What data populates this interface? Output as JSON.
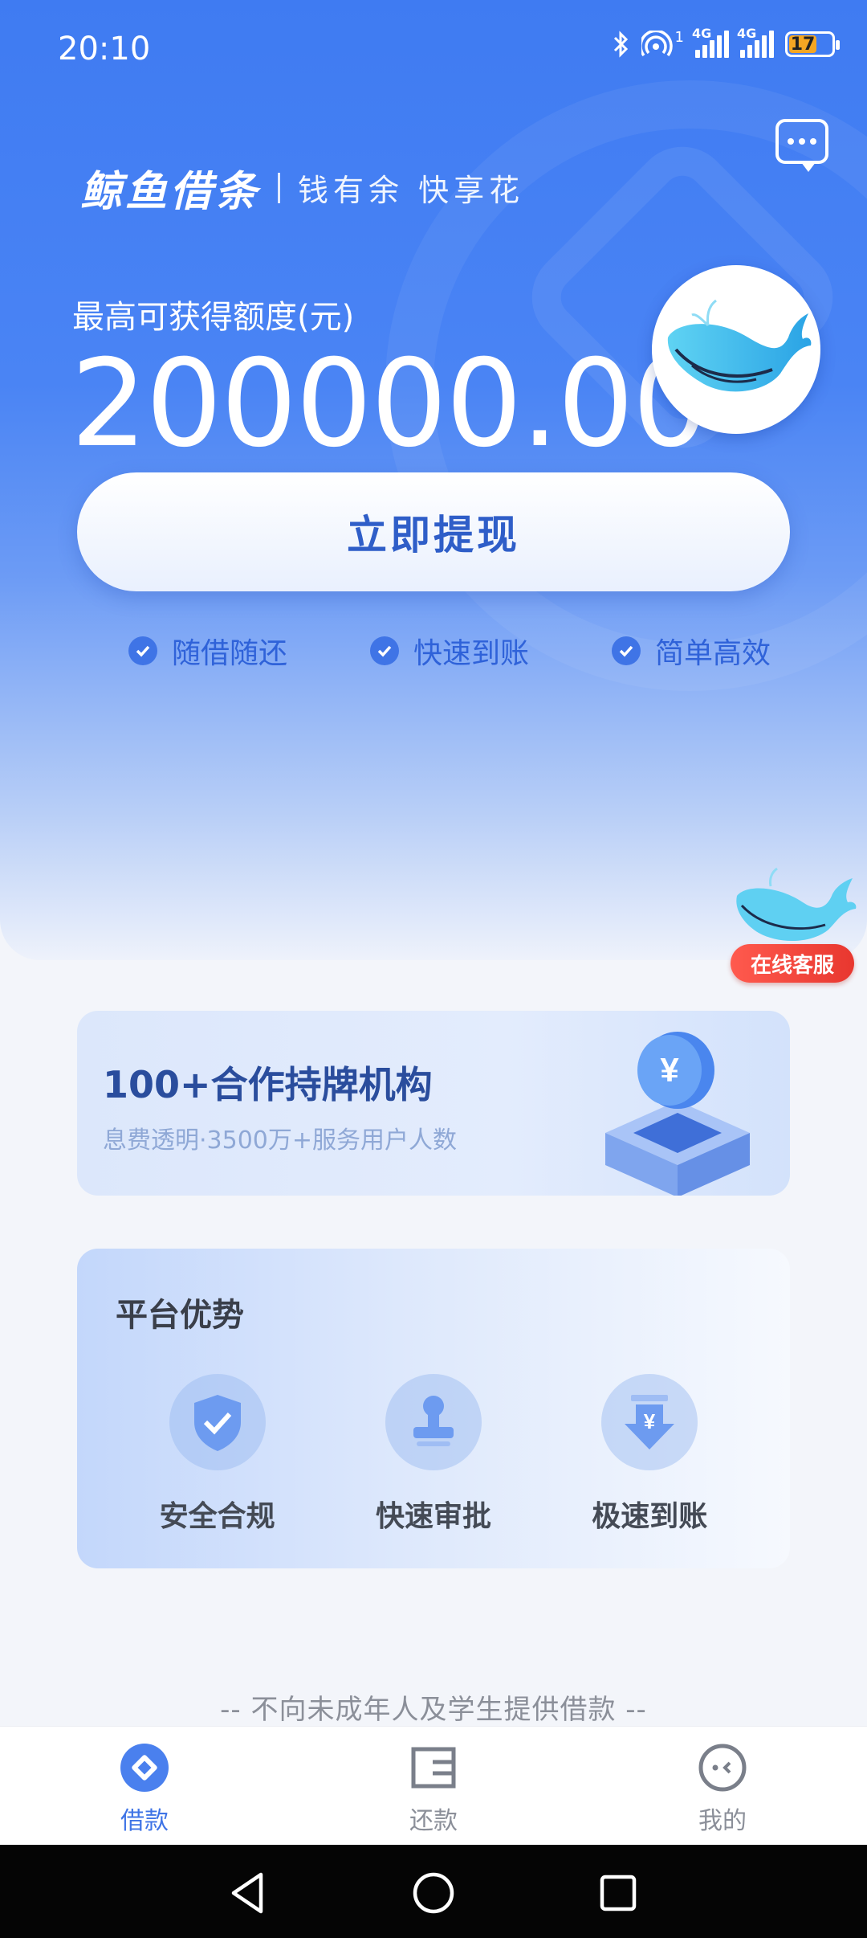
{
  "status_bar": {
    "time": "20:10",
    "network_1": "4G",
    "network_2": "4G",
    "hotspot_badge": "1",
    "battery": "17"
  },
  "header": {
    "brand_name": "鲸鱼借条",
    "slogan": "钱有余  快享花"
  },
  "limit": {
    "label": "最高可获得额度(元)",
    "amount": "200000.00"
  },
  "cta": {
    "label": "立即提现"
  },
  "features": [
    {
      "label": "随借随还"
    },
    {
      "label": "快速到账"
    },
    {
      "label": "简单高效"
    }
  ],
  "service": {
    "label": "在线客服"
  },
  "partner": {
    "title": "100+合作持牌机构",
    "subtitle": "息费透明·3500万+服务用户人数"
  },
  "advantages": {
    "title": "平台优势",
    "items": [
      {
        "label": "安全合规",
        "icon": "shield-check-icon"
      },
      {
        "label": "快速审批",
        "icon": "stamp-icon"
      },
      {
        "label": "极速到账",
        "icon": "yuan-arrow-down-icon"
      }
    ]
  },
  "notice": "-- 不向未成年人及学生提供借款 --",
  "tabbar": {
    "tabs": [
      {
        "label": "借款",
        "active": true
      },
      {
        "label": "还款",
        "active": false
      },
      {
        "label": "我的",
        "active": false
      }
    ]
  },
  "colors": {
    "primary": "#3f74e6",
    "hero_top": "#3f7bf2",
    "service_badge": "#e8372f"
  }
}
